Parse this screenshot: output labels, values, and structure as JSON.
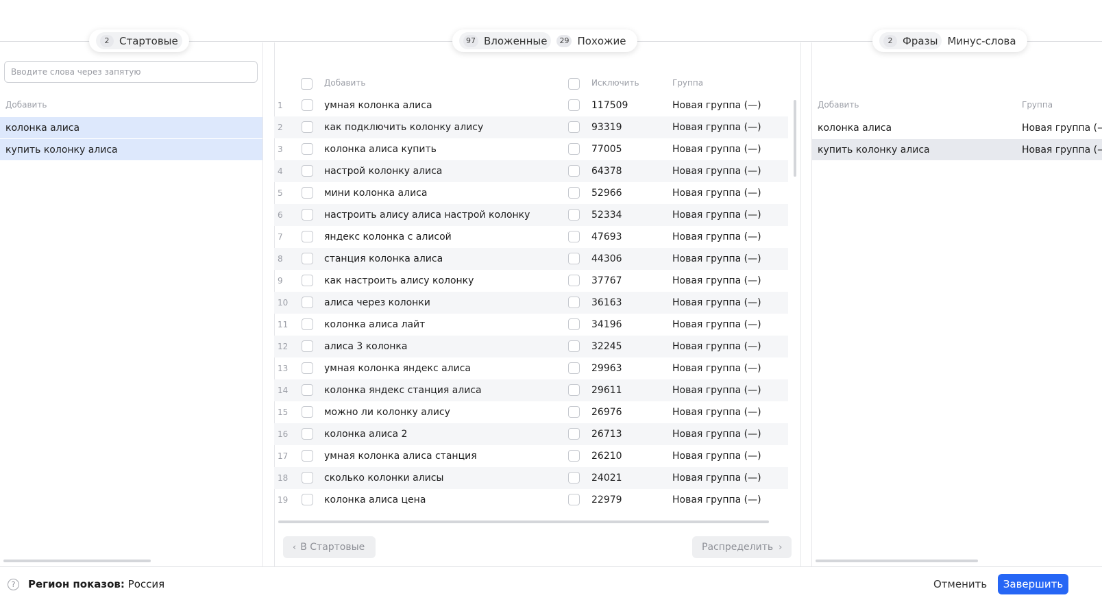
{
  "left_panel": {
    "tab": {
      "count": "2",
      "label": "Стартовые"
    },
    "input_placeholder": "Вводите слова через запятую",
    "col_add": "Добавить",
    "rows": [
      "колонка алиса",
      "купить колонку алиса"
    ]
  },
  "middle_panel": {
    "tabs": [
      {
        "count": "97",
        "label": "Вложенные"
      },
      {
        "count": "29",
        "label": "Похожие"
      }
    ],
    "col_add": "Добавить",
    "col_exclude": "Исключить",
    "col_group": "Группа",
    "rows": [
      {
        "n": "1",
        "phrase": "умная колонка алиса",
        "count": "117509",
        "group": "Новая группа (—)"
      },
      {
        "n": "2",
        "phrase": "как подключить колонку алису",
        "count": "93319",
        "group": "Новая группа (—)"
      },
      {
        "n": "3",
        "phrase": "колонка алиса купить",
        "count": "77005",
        "group": "Новая группа (—)"
      },
      {
        "n": "4",
        "phrase": "настрой колонку алиса",
        "count": "64378",
        "group": "Новая группа (—)"
      },
      {
        "n": "5",
        "phrase": "мини колонка алиса",
        "count": "52966",
        "group": "Новая группа (—)"
      },
      {
        "n": "6",
        "phrase": "настроить алису алиса настрой колонку",
        "count": "52334",
        "group": "Новая группа (—)"
      },
      {
        "n": "7",
        "phrase": "яндекс колонка с алисой",
        "count": "47693",
        "group": "Новая группа (—)"
      },
      {
        "n": "8",
        "phrase": "станция колонка алиса",
        "count": "44306",
        "group": "Новая группа (—)"
      },
      {
        "n": "9",
        "phrase": "как настроить алису колонку",
        "count": "37767",
        "group": "Новая группа (—)"
      },
      {
        "n": "10",
        "phrase": "алиса через колонки",
        "count": "36163",
        "group": "Новая группа (—)"
      },
      {
        "n": "11",
        "phrase": "колонка алиса лайт",
        "count": "34196",
        "group": "Новая группа (—)"
      },
      {
        "n": "12",
        "phrase": "алиса 3 колонка",
        "count": "32245",
        "group": "Новая группа (—)"
      },
      {
        "n": "13",
        "phrase": "умная колонка яндекс алиса",
        "count": "29963",
        "group": "Новая группа (—)"
      },
      {
        "n": "14",
        "phrase": "колонка яндекс станция алиса",
        "count": "29611",
        "group": "Новая группа (—)"
      },
      {
        "n": "15",
        "phrase": "можно ли колонку алису",
        "count": "26976",
        "group": "Новая группа (—)"
      },
      {
        "n": "16",
        "phrase": "колонка алиса 2",
        "count": "26713",
        "group": "Новая группа (—)"
      },
      {
        "n": "17",
        "phrase": "умная колонка алиса станция",
        "count": "26210",
        "group": "Новая группа (—)"
      },
      {
        "n": "18",
        "phrase": "сколько колонки алисы",
        "count": "24021",
        "group": "Новая группа (—)"
      },
      {
        "n": "19",
        "phrase": "колонка алиса цена",
        "count": "22979",
        "group": "Новая группа (—)"
      }
    ],
    "btn_back": "В Стартовые",
    "btn_distribute": "Распределить"
  },
  "right_panel": {
    "tabs": [
      {
        "count": "2",
        "label": "Фразы"
      },
      {
        "count": "",
        "label": "Минус-слова"
      }
    ],
    "col_add": "Добавить",
    "col_group": "Группа",
    "rows": [
      {
        "phrase": "колонка алиса",
        "group": "Новая группа (—)"
      },
      {
        "phrase": "купить колонку алиса",
        "group": "Новая группа (—)"
      }
    ]
  },
  "footer": {
    "region_label": "Регион показов:",
    "region_value": "Россия",
    "cancel": "Отменить",
    "finish": "Завершить"
  }
}
